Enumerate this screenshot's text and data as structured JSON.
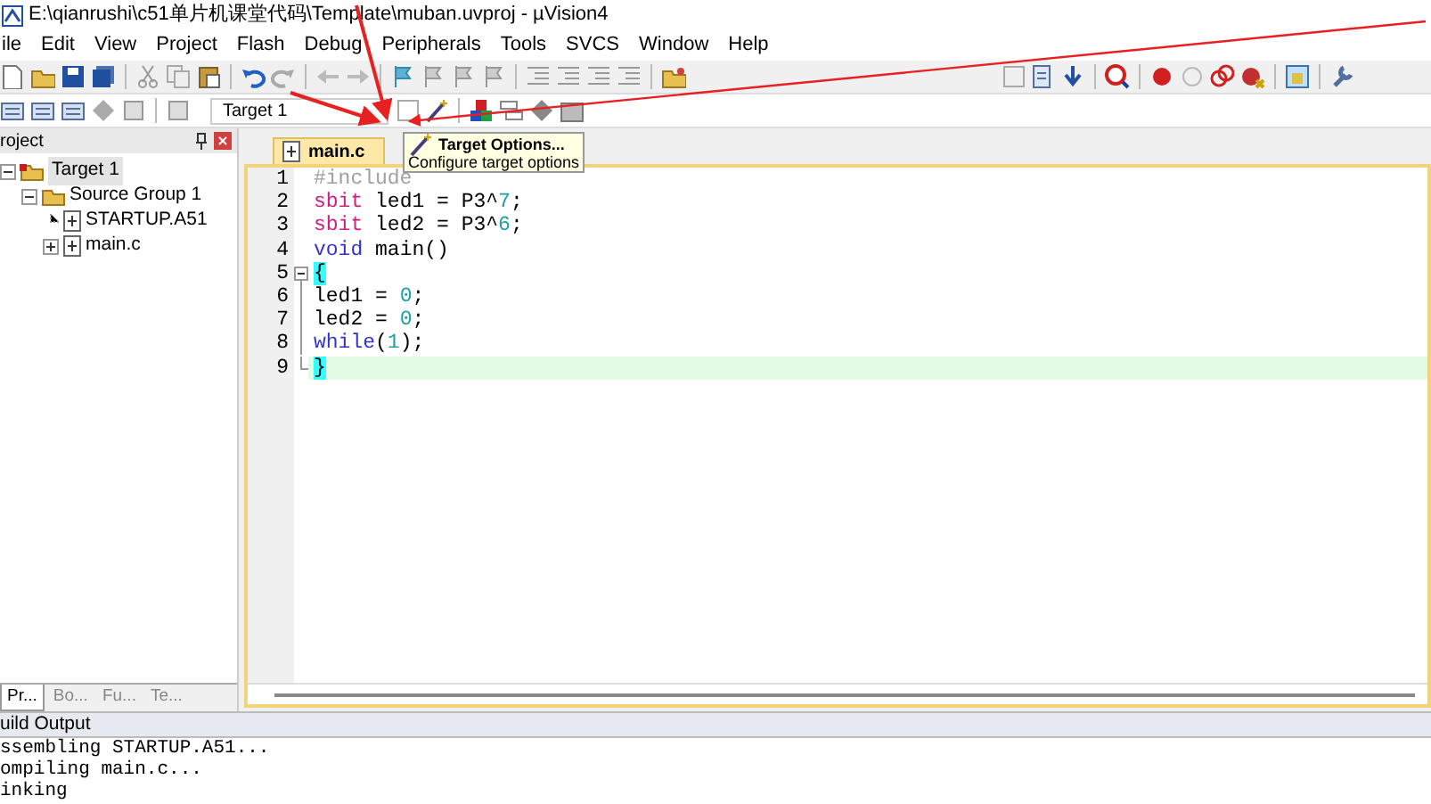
{
  "window": {
    "title": "E:\\qianrushi\\c51单片机课堂代码\\Template\\muban.uvproj - µVision4"
  },
  "menu": [
    "ile",
    "Edit",
    "View",
    "Project",
    "Flash",
    "Debug",
    "Peripherals",
    "Tools",
    "SVCS",
    "Window",
    "Help"
  ],
  "toolbar": {
    "target_select": "Target 1"
  },
  "tooltip": {
    "title": "Target Options...",
    "description": "Configure target options"
  },
  "project_panel": {
    "title": "roject",
    "tree": [
      {
        "label": "Target 1",
        "kind": "target",
        "expanded": true,
        "selected": true,
        "children": [
          {
            "label": "Source Group 1",
            "kind": "group",
            "expanded": true,
            "selected": false,
            "children": [
              {
                "label": "STARTUP.A51",
                "kind": "file",
                "selected": false
              },
              {
                "label": "main.c",
                "kind": "file",
                "expanded": false,
                "selected": false
              }
            ]
          }
        ]
      }
    ],
    "tabs": [
      {
        "label": "Pr...",
        "selected": true
      },
      {
        "label": "Bo...",
        "selected": false
      },
      {
        "label": "Fu...",
        "selected": false
      },
      {
        "label": "Te...",
        "selected": false
      }
    ]
  },
  "editor": {
    "tab": "main.c",
    "lines": [
      {
        "number": "1",
        "kind": "plain",
        "current": false,
        "tokens": [
          {
            "text": "#include",
            "kind": "preproc"
          }
        ]
      },
      {
        "number": "2",
        "kind": "plain",
        "current": false,
        "tokens": [
          {
            "text": "sbit",
            "kind": "type"
          },
          {
            "text": " led1 = P3^",
            "kind": "plain"
          },
          {
            "text": "7",
            "kind": "number"
          },
          {
            "text": ";",
            "kind": "plain"
          }
        ]
      },
      {
        "number": "3",
        "kind": "plain",
        "current": false,
        "tokens": [
          {
            "text": "sbit",
            "kind": "type"
          },
          {
            "text": " led2 = P3^",
            "kind": "plain"
          },
          {
            "text": "6",
            "kind": "number"
          },
          {
            "text": ";",
            "kind": "plain"
          }
        ]
      },
      {
        "number": "4",
        "kind": "plain",
        "current": false,
        "tokens": [
          {
            "text": "void",
            "kind": "keyword"
          },
          {
            "text": " main()",
            "kind": "plain"
          }
        ]
      },
      {
        "number": "5",
        "kind": "fold-start",
        "current": false,
        "tokens": [
          {
            "text": "{",
            "kind": "brace"
          }
        ]
      },
      {
        "number": "6",
        "kind": "fold-body",
        "current": false,
        "tokens": [
          {
            "text": "led1 = ",
            "kind": "plain"
          },
          {
            "text": "0",
            "kind": "number"
          },
          {
            "text": ";",
            "kind": "plain"
          }
        ]
      },
      {
        "number": "7",
        "kind": "fold-body",
        "current": false,
        "tokens": [
          {
            "text": "led2 = ",
            "kind": "plain"
          },
          {
            "text": "0",
            "kind": "number"
          },
          {
            "text": ";",
            "kind": "plain"
          }
        ]
      },
      {
        "number": "8",
        "kind": "fold-body",
        "current": false,
        "tokens": [
          {
            "text": "while",
            "kind": "keyword"
          },
          {
            "text": "(",
            "kind": "plain"
          },
          {
            "text": "1",
            "kind": "number"
          },
          {
            "text": ");",
            "kind": "plain"
          }
        ]
      },
      {
        "number": "9",
        "kind": "fold-end",
        "current": true,
        "tokens": [
          {
            "text": "}",
            "kind": "brace"
          }
        ]
      }
    ]
  },
  "build_output": {
    "title": "uild Output",
    "lines": [
      "ssembling STARTUP.A51...",
      "ompiling main.c...",
      "inking"
    ]
  }
}
